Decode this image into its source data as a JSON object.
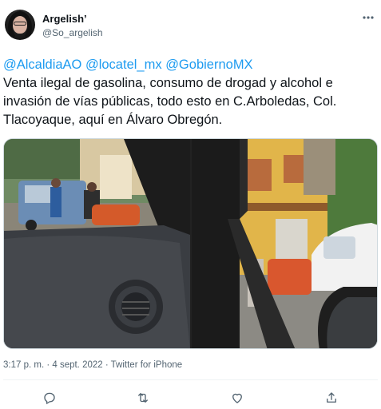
{
  "user": {
    "display_name": "Argelish’",
    "handle": "@So_argelish"
  },
  "tweet": {
    "mentions": [
      "@AlcaldiaAO",
      "@locatel_mx",
      "@GobiernoMX"
    ],
    "text": " Venta ilegal de gasolina, consumo de drogad y alcohol e invasión de vías públicas, todo esto en C.Arboledas, Col. Tlacoyaque, aquí en Álvaro Obregón.",
    "meta": "3:17 p. m. · 4 sept. 2022 · Twitter for iPhone"
  },
  "icons": {
    "more": "more-options-icon",
    "reply": "reply-icon",
    "retweet": "retweet-icon",
    "like": "like-icon",
    "share": "share-icon"
  },
  "colors": {
    "accent": "#1d9bf0",
    "secondary_text": "#536471",
    "primary_text": "#0f1419"
  }
}
